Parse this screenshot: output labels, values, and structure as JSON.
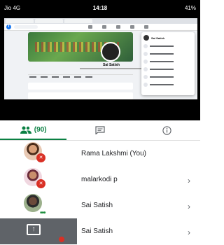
{
  "status_bar": {
    "carrier": "Jio 4G",
    "time": "14:18",
    "battery": "41%"
  },
  "shared_screen": {
    "profile_name": "Sai Satish",
    "dropdown_name": "Sai Satish"
  },
  "tabs": {
    "people_count": "(90)"
  },
  "participants": [
    {
      "name": "Rama Lakshmi (You)",
      "muted": true,
      "has_chevron": false
    },
    {
      "name": "malarkodi p",
      "muted": true,
      "has_chevron": true
    },
    {
      "name": "Sai Satish",
      "muted": false,
      "has_chevron": true
    },
    {
      "name": "Sai Satish",
      "muted": true,
      "has_chevron": true,
      "presenting": true
    }
  ],
  "colors": {
    "accent_green": "#0b8043",
    "mute_red": "#d93025",
    "fb_blue": "#1877f2"
  },
  "icons": {
    "people": "people-icon",
    "chat": "chat-icon",
    "info": "info-icon",
    "chevron": "chevron-right-icon",
    "mic_off": "mic-off-icon",
    "present": "present-screen-icon"
  }
}
